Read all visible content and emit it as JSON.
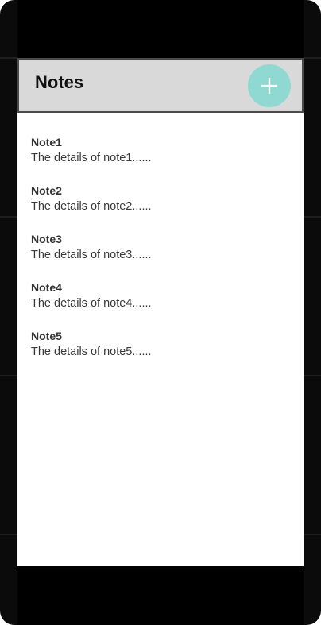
{
  "app": {
    "title": "Notes",
    "add_button_icon": "plus-icon",
    "accent_color": "#8fd9d2"
  },
  "notes": [
    {
      "title": "Note1",
      "details": "The details of note1......"
    },
    {
      "title": "Note2",
      "details": "The details of note2......"
    },
    {
      "title": "Note3",
      "details": "The details of note3......"
    },
    {
      "title": "Note4",
      "details": "The details of note4......"
    },
    {
      "title": "Note5",
      "details": "The details of note5......"
    }
  ]
}
